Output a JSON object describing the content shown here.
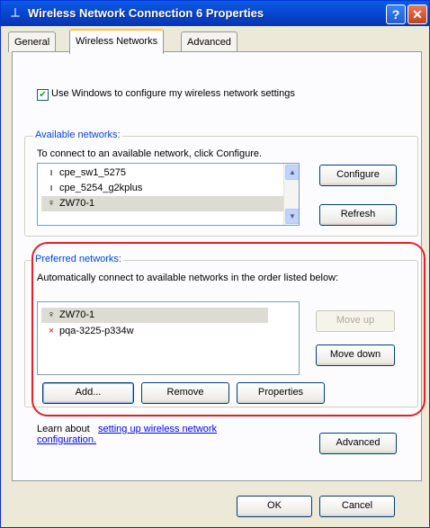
{
  "window": {
    "title": "Wireless Network Connection 6 Properties",
    "help_label": "?",
    "close_label": "✕"
  },
  "tabs": [
    {
      "label": "General",
      "active": false
    },
    {
      "label": "Wireless Networks",
      "active": true
    },
    {
      "label": "Advanced",
      "active": false
    }
  ],
  "use_windows_checkbox": {
    "label": "Use Windows to configure my wireless network settings",
    "checked": true
  },
  "available": {
    "title": "Available networks:",
    "instruction": "To connect to an available network, click Configure.",
    "items": [
      {
        "name": "cpe_sw1_5275",
        "icon": "antenna-icon",
        "selected": false
      },
      {
        "name": "cpe_5254_g2kplus",
        "icon": "antenna-icon",
        "selected": false
      },
      {
        "name": "ZW70-1",
        "icon": "wireless-network-icon",
        "selected": true
      }
    ],
    "configure_label": "Configure",
    "refresh_label": "Refresh"
  },
  "preferred": {
    "title": "Preferred networks:",
    "instruction": "Automatically connect to available networks in the order listed below:",
    "items": [
      {
        "name": "ZW70-1",
        "icon": "wireless-network-icon",
        "selected": true
      },
      {
        "name": "pqa-3225-p334w",
        "icon": "disconnected-network-icon",
        "selected": false
      }
    ],
    "move_up_label": "Move up",
    "move_down_label": "Move down",
    "add_label": "Add...",
    "remove_label": "Remove",
    "properties_label": "Properties"
  },
  "learn": {
    "prefix": "Learn about ",
    "link_text": "setting up wireless network configuration."
  },
  "advanced_label": "Advanced",
  "ok_label": "OK",
  "cancel_label": "Cancel",
  "colors": {
    "title_bar": "#0842c9",
    "group_title": "#0046d5",
    "highlight_ring": "#e0202a"
  }
}
